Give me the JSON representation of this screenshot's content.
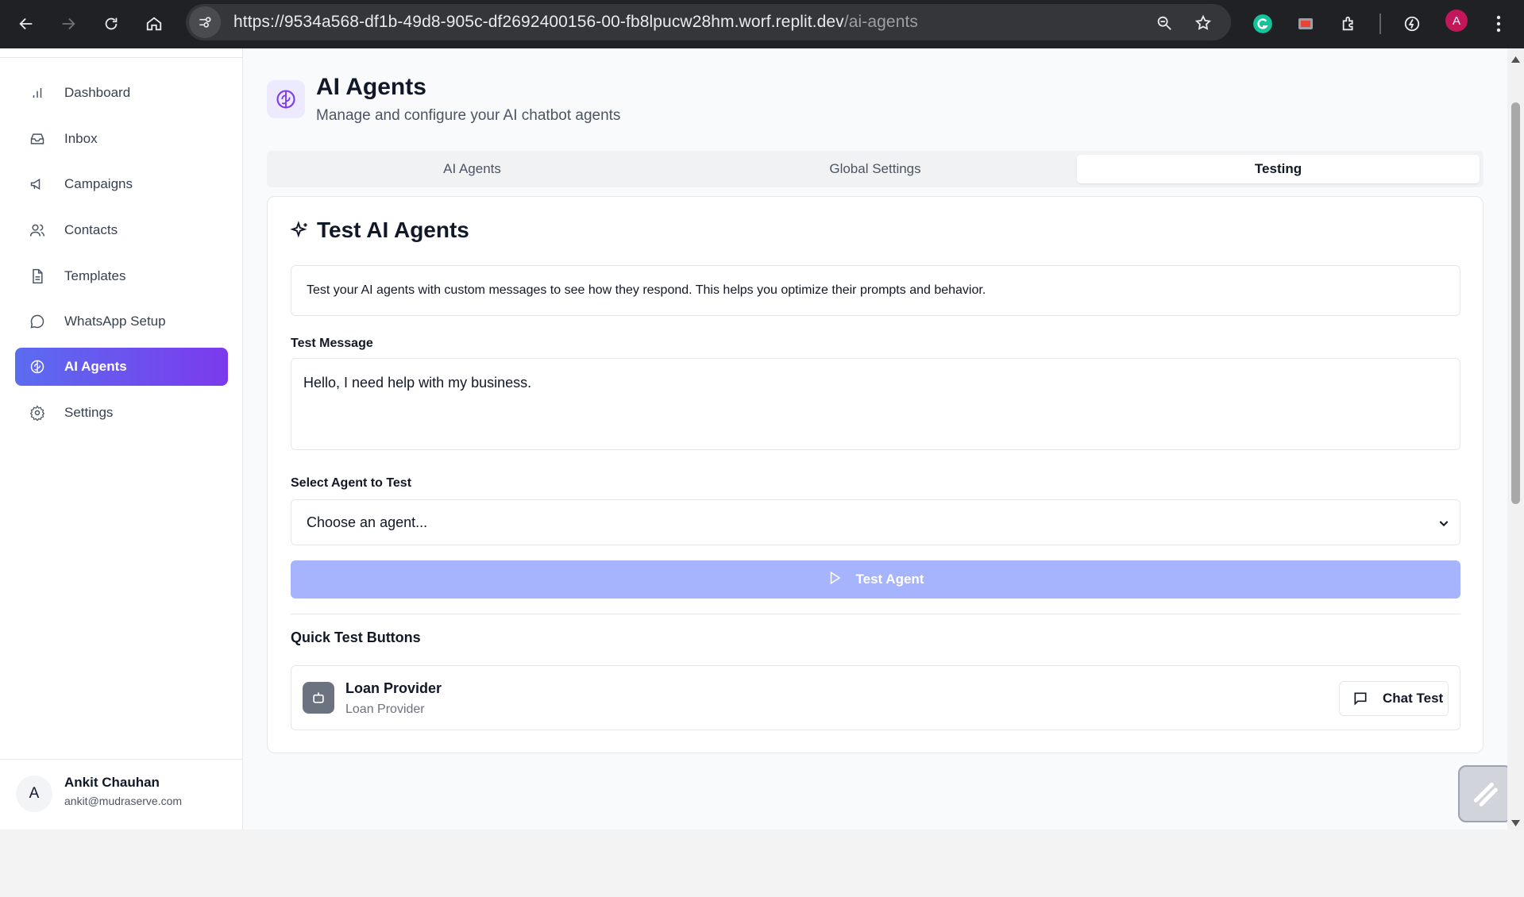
{
  "browser": {
    "url_host": "https://9534a568-df1b-49d8-905c-df2692400156-00-fb8lpucw28hm.worf.replit.dev",
    "url_path": "/ai-agents",
    "profile_initial": "A"
  },
  "sidebar": {
    "items": [
      {
        "label": "Dashboard",
        "icon": "bar-chart-icon"
      },
      {
        "label": "Inbox",
        "icon": "inbox-icon"
      },
      {
        "label": "Campaigns",
        "icon": "megaphone-icon"
      },
      {
        "label": "Contacts",
        "icon": "users-icon"
      },
      {
        "label": "Templates",
        "icon": "file-text-icon"
      },
      {
        "label": "WhatsApp Setup",
        "icon": "message-circle-icon"
      },
      {
        "label": "AI Agents",
        "icon": "brain-icon",
        "active": true
      },
      {
        "label": "Settings",
        "icon": "gear-icon"
      }
    ],
    "user": {
      "initial": "A",
      "name": "Ankit Chauhan",
      "email": "ankit@mudraserve.com"
    }
  },
  "header": {
    "title": "AI Agents",
    "subtitle": "Manage and configure your AI chatbot agents"
  },
  "tabs": [
    {
      "label": "AI Agents"
    },
    {
      "label": "Global Settings"
    },
    {
      "label": "Testing",
      "active": true
    }
  ],
  "testing": {
    "title": "Test AI Agents",
    "info": "Test your AI agents with custom messages to see how they respond. This helps you optimize their prompts and behavior.",
    "message_label": "Test Message",
    "message_value": "Hello, I need help with my business.",
    "agent_label": "Select Agent to Test",
    "agent_placeholder": "Choose an agent...",
    "test_button": "Test Agent",
    "quick_title": "Quick Test Buttons",
    "agents": [
      {
        "name": "Loan Provider",
        "description": "Loan Provider",
        "button": "Chat Test"
      }
    ]
  },
  "colors": {
    "accent_start": "#5b6cf0",
    "accent_end": "#7c3aed",
    "disabled_button": "#a5b4fc"
  }
}
